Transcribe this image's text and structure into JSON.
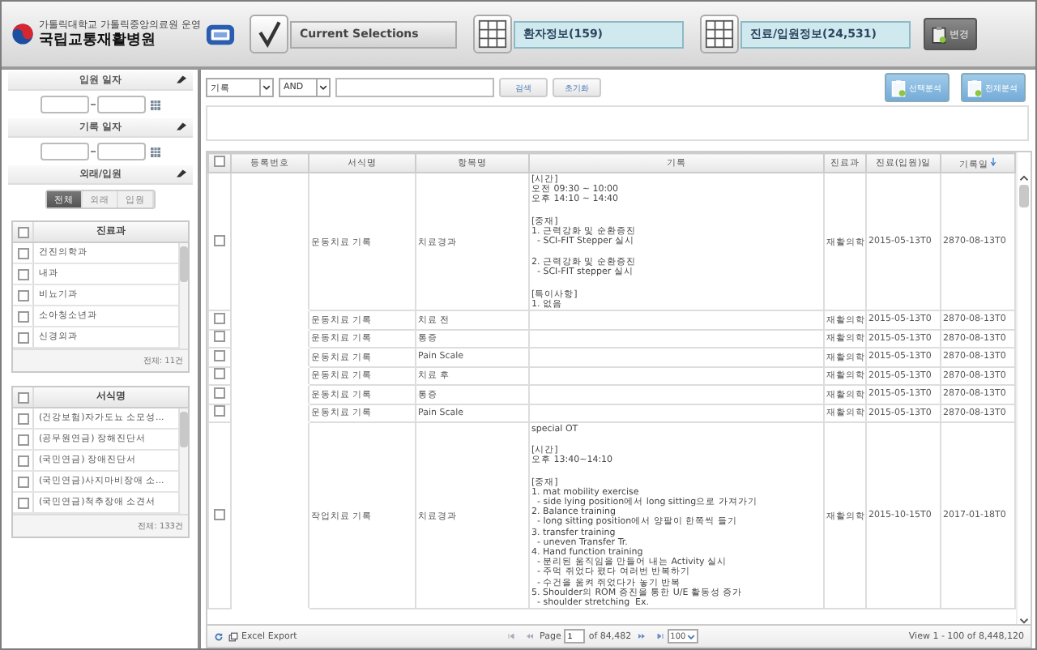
{
  "header": {
    "org_line": "가톨릭대학교 가톨릭중앙의료원 운영",
    "hospital": "국립교통재활병원",
    "current_selections": "Current Selections",
    "summaries": [
      {
        "label": "환자정보(159)"
      },
      {
        "label": "진료/입원정보(24,531)"
      }
    ],
    "change_button": "변경"
  },
  "filters": [
    {
      "kind": "date_range",
      "title": "입원 일자"
    },
    {
      "kind": "date_range",
      "title": "기록 일자"
    },
    {
      "kind": "segment",
      "title": "외래/입원",
      "options": [
        {
          "label": "전체",
          "selected": true
        },
        {
          "label": "외래",
          "selected": false
        },
        {
          "label": "입원",
          "selected": false
        }
      ]
    }
  ],
  "lists": [
    {
      "title": "진료과",
      "all_checked": false,
      "items": [
        {
          "label": "건진의학과",
          "checked": false
        },
        {
          "label": "내과",
          "checked": false
        },
        {
          "label": "비뇨기과",
          "checked": false
        },
        {
          "label": "소아청소년과",
          "checked": false
        },
        {
          "label": "신경외과",
          "checked": false
        }
      ],
      "footer": "전체: 11건"
    },
    {
      "title": "서식명",
      "all_checked": false,
      "items": [
        {
          "label": "(건강보험)자가도뇨 소모성...",
          "checked": false
        },
        {
          "label": "(공무원연금) 장해진단서",
          "checked": false
        },
        {
          "label": "(국민연금) 장애진단서",
          "checked": false
        },
        {
          "label": "(국민연금)사지마비장애 소...",
          "checked": false
        },
        {
          "label": "(국민연금)척추장애 소견서",
          "checked": false
        }
      ],
      "footer": "전체: 133건"
    }
  ],
  "search": {
    "field": "기록",
    "operator": "AND",
    "buttons": [
      "검색",
      "초기화"
    ]
  },
  "analysis_buttons": [
    "선택분석",
    "전체분석"
  ],
  "table": {
    "all_checked": false,
    "columns": [
      {
        "label": "등록번호",
        "sorted": false
      },
      {
        "label": "서식명",
        "sorted": false
      },
      {
        "label": "항목명",
        "sorted": false
      },
      {
        "label": "기록",
        "sorted": false
      },
      {
        "label": "진료과",
        "sorted": false
      },
      {
        "label": "진료(입원)일",
        "sorted": false
      },
      {
        "label": "기록일",
        "sorted": true
      }
    ],
    "rows": [
      {
        "checked": false,
        "form": "운동치료 기록",
        "item": "치료경과",
        "record": [
          [
            "[시간]",
            "오전 09:30 ~ 10:00",
            "오후 14:10 ~ 14:40"
          ],
          [
            "[중재]",
            "1. 근력강화 및 순환증진",
            "  - SCI-FIT Stepper 실시"
          ],
          [
            "2. 근력강화 및 순환증진",
            "  - SCI-FIT stepper 실시"
          ],
          [
            "[특이사항]",
            "1. 없음"
          ]
        ],
        "dept": "재활의학",
        "visit": "2015-05-13T0",
        "recorded": "2870-08-13T0"
      },
      {
        "checked": false,
        "form": "운동치료 기록",
        "item": "치료 전",
        "dept": "재활의학",
        "visit": "2015-05-13T0",
        "recorded": "2870-08-13T0"
      },
      {
        "checked": false,
        "form": "운동치료 기록",
        "item": "통증",
        "dept": "재활의학",
        "visit": "2015-05-13T0",
        "recorded": "2870-08-13T0"
      },
      {
        "checked": false,
        "form": "운동치료 기록",
        "item": "Pain Scale",
        "dept": "재활의학",
        "visit": "2015-05-13T0",
        "recorded": "2870-08-13T0"
      },
      {
        "checked": false,
        "form": "운동치료 기록",
        "item": "치료 후",
        "dept": "재활의학",
        "visit": "2015-05-13T0",
        "recorded": "2870-08-13T0"
      },
      {
        "checked": false,
        "form": "운동치료 기록",
        "item": "통증",
        "dept": "재활의학",
        "visit": "2015-05-13T0",
        "recorded": "2870-08-13T0"
      },
      {
        "checked": false,
        "form": "운동치료 기록",
        "item": "Pain Scale",
        "dept": "재활의학",
        "visit": "2015-05-13T0",
        "recorded": "2870-08-13T0"
      },
      {
        "checked": false,
        "form": "작업치료 기록",
        "item": "치료경과",
        "record": [
          [
            "special OT"
          ],
          [
            "[시간]",
            "오후 13:40~14:10"
          ],
          [
            "[중재]",
            "1. mat mobility exercise",
            "  - side lying position에서 long sitting으로 가져가기",
            "2. Balance training",
            "  - long sitting position에서 양팔이 한쪽씩 들기",
            "3. transfer training",
            "  - uneven Transfer Tr.",
            "4. Hand function training",
            "  - 분리된 움직임을 만들어 내는 Activity 실시",
            "  - 주먹 쥐었다 폈다 여러번 반복하기",
            "  - 수건을 움켜 쥐었다가 놓기 반복",
            "5. Shoulder의 ROM 증진을 통한 U/E 활동성 증가",
            "  - shoulder stretching  Ex."
          ]
        ],
        "dept": "재활의학",
        "visit": "2015-10-15T0",
        "recorded": "2017-01-18T0"
      }
    ]
  },
  "pager": {
    "export": "Excel Export",
    "page_label": "Page",
    "page": "1",
    "of": "of 84,482",
    "page_size": "100",
    "view": "View 1 - 100 of 8,448,120"
  }
}
